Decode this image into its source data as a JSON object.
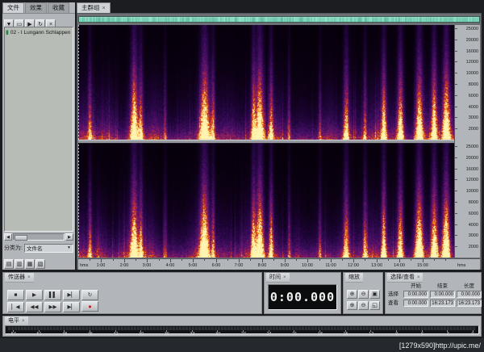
{
  "icons": {
    "close": "×",
    "panel-menu": "≡",
    "dropdown": "▼",
    "stop": "■",
    "play": "▶",
    "pause": "▌▌",
    "play-to-end": "▶▏",
    "play-loop": "↻",
    "go-start": "▏◀",
    "rewind": "◀◀",
    "fast-forward": "▶▶",
    "go-end": "▶▏",
    "record": "●",
    "zoom-in": "⊕",
    "zoom-out": "⊖",
    "zoom-full": "▣",
    "zoom-in-vertical": "⊕",
    "zoom-out-vertical": "⊖",
    "zoom-selection": "◱",
    "import-file": "▼",
    "open-file": "▭",
    "play-file": "▶",
    "loop-file": "↻",
    "remove-file": "×",
    "audio-file": "▮",
    "scroll-left": "◀",
    "scroll-right": "▶",
    "view-grid": "▤",
    "view-list": "▥",
    "auto-play": "▦",
    "options": "▧"
  },
  "files_panel": {
    "tabs": [
      {
        "label": "文件",
        "active": true
      },
      {
        "label": "效果",
        "active": false
      },
      {
        "label": "收藏",
        "active": false
      }
    ],
    "toolbar": [
      "import-file",
      "open-file",
      "play-file",
      "loop-file",
      "remove-file"
    ],
    "files": [
      {
        "icon": "audio-file",
        "name": "02 - I Lungann Schlappen"
      }
    ],
    "sort_label": "分类为:",
    "sort_value": "文件名",
    "view_toggles": [
      "view-grid",
      "view-list",
      "auto-play",
      "options"
    ]
  },
  "main_group": {
    "tab": "主群组",
    "freq_labels": [
      "25000",
      "20000",
      "16000",
      "12000",
      "10000",
      "8000",
      "6000",
      "4000",
      "3000",
      "2000"
    ],
    "time_ruler": {
      "unit": "hms",
      "labels": [
        "1:00",
        "2:00",
        "3:00",
        "4:00",
        "5:00",
        "6:00",
        "7:00",
        "8:00",
        "9:00",
        "10:00",
        "11:00",
        "12:00",
        "13:00",
        "14:00",
        "15:00"
      ]
    }
  },
  "transport": {
    "title": "传送器",
    "row1": [
      "stop",
      "play",
      "pause",
      "play-to-end",
      "play-loop"
    ],
    "row2": [
      "go-start",
      "rewind",
      "fast-forward",
      "go-end",
      "record"
    ]
  },
  "time_panel": {
    "title": "时间",
    "value": "0:00.000"
  },
  "zoom_panel": {
    "title": "缩放",
    "row1": [
      "zoom-in",
      "zoom-out",
      "zoom-full"
    ],
    "row2": [
      "zoom-in-vertical",
      "zoom-out-vertical",
      "zoom-selection"
    ]
  },
  "selection_view": {
    "title": "选择/查看",
    "columns": [
      "开始",
      "结束",
      "长度"
    ],
    "rows": [
      {
        "label": "选择",
        "values": [
          "0:00.000",
          "0:00.000",
          "0:00.000"
        ]
      },
      {
        "label": "查看",
        "values": [
          "0:00.000",
          "16:23.173",
          "16:23.173"
        ]
      }
    ]
  },
  "levels": {
    "title": "电平",
    "ticks": [
      "-54",
      "-51",
      "-48",
      "-45",
      "-42",
      "-39",
      "-36",
      "-33",
      "-30",
      "-27",
      "-24",
      "-21",
      "-18",
      "-15",
      "-12",
      "-9",
      "-6",
      "-3",
      "0"
    ]
  },
  "status": {
    "watermark": "[1279x590]http://upic.me/"
  },
  "spectrogram": {
    "channels": 2,
    "seeds": [
      7,
      131
    ],
    "palette": [
      {
        "v": 0.0,
        "c": "#050008"
      },
      {
        "v": 0.08,
        "c": "#0d0116"
      },
      {
        "v": 0.18,
        "c": "#1c0433"
      },
      {
        "v": 0.3,
        "c": "#320a52"
      },
      {
        "v": 0.42,
        "c": "#4e1169"
      },
      {
        "v": 0.54,
        "c": "#71176b"
      },
      {
        "v": 0.64,
        "c": "#9c1e55"
      },
      {
        "v": 0.74,
        "c": "#c63426"
      },
      {
        "v": 0.84,
        "c": "#ef6a0e"
      },
      {
        "v": 0.92,
        "c": "#ffab1f"
      },
      {
        "v": 1.0,
        "c": "#fff3b0"
      }
    ],
    "bursts": [
      {
        "pos": 0.03,
        "w": 0.005,
        "i": 0.5
      },
      {
        "pos": 0.148,
        "w": 0.01,
        "i": 0.95
      },
      {
        "pos": 0.166,
        "w": 0.006,
        "i": 0.6
      },
      {
        "pos": 0.23,
        "w": 0.004,
        "i": 0.35
      },
      {
        "pos": 0.335,
        "w": 0.012,
        "i": 1.0
      },
      {
        "pos": 0.358,
        "w": 0.005,
        "i": 0.55
      },
      {
        "pos": 0.465,
        "w": 0.006,
        "i": 0.75
      },
      {
        "pos": 0.482,
        "w": 0.01,
        "i": 1.0
      },
      {
        "pos": 0.512,
        "w": 0.006,
        "i": 0.65
      },
      {
        "pos": 0.56,
        "w": 0.004,
        "i": 0.4
      },
      {
        "pos": 0.642,
        "w": 0.004,
        "i": 0.35
      },
      {
        "pos": 0.712,
        "w": 0.008,
        "i": 0.7
      },
      {
        "pos": 0.762,
        "w": 0.005,
        "i": 0.5
      },
      {
        "pos": 0.812,
        "w": 0.007,
        "i": 0.8
      },
      {
        "pos": 0.856,
        "w": 0.008,
        "i": 0.85
      },
      {
        "pos": 0.906,
        "w": 0.01,
        "i": 0.95
      },
      {
        "pos": 0.946,
        "w": 0.008,
        "i": 0.9
      },
      {
        "pos": 0.978,
        "w": 0.01,
        "i": 1.0
      }
    ],
    "dips": [
      {
        "pos": 0.26,
        "w": 0.035,
        "d": 0.35
      },
      {
        "pos": 0.62,
        "w": 0.05,
        "d": 0.45
      },
      {
        "pos": 0.88,
        "w": 0.012,
        "d": 0.3
      }
    ],
    "overview_color": "#79c9ae"
  }
}
